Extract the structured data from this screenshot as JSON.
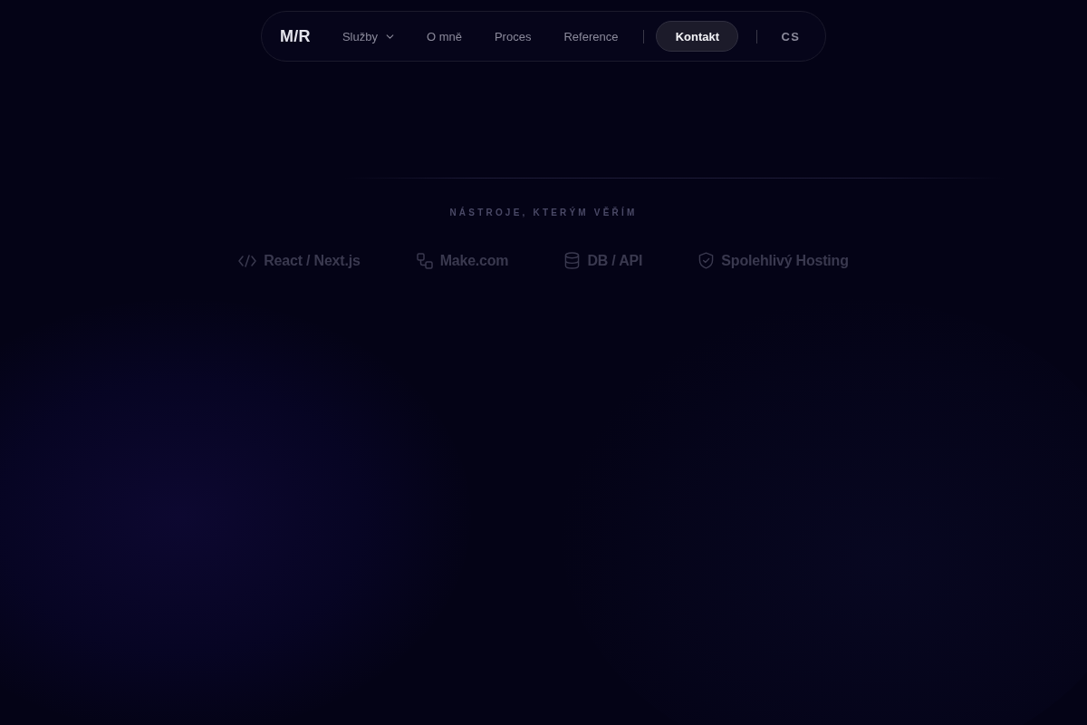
{
  "nav": {
    "logo": "M/R",
    "links": [
      {
        "label": "Služby",
        "has_menu": true
      },
      {
        "label": "O mně",
        "has_menu": false
      },
      {
        "label": "Proces",
        "has_menu": false
      },
      {
        "label": "Reference",
        "has_menu": false
      }
    ],
    "contact_button": "Kontakt",
    "language": "CS"
  },
  "tools": {
    "heading": "NÁSTROJE, KTERÝM VĚŘÍM",
    "items": [
      {
        "label": "React / Next.js",
        "kind": "code"
      },
      {
        "label": "Make.com",
        "kind": "workflow"
      },
      {
        "label": "DB / API",
        "kind": "database"
      },
      {
        "label": "Spolehlivý Hosting",
        "kind": "shield"
      }
    ]
  }
}
